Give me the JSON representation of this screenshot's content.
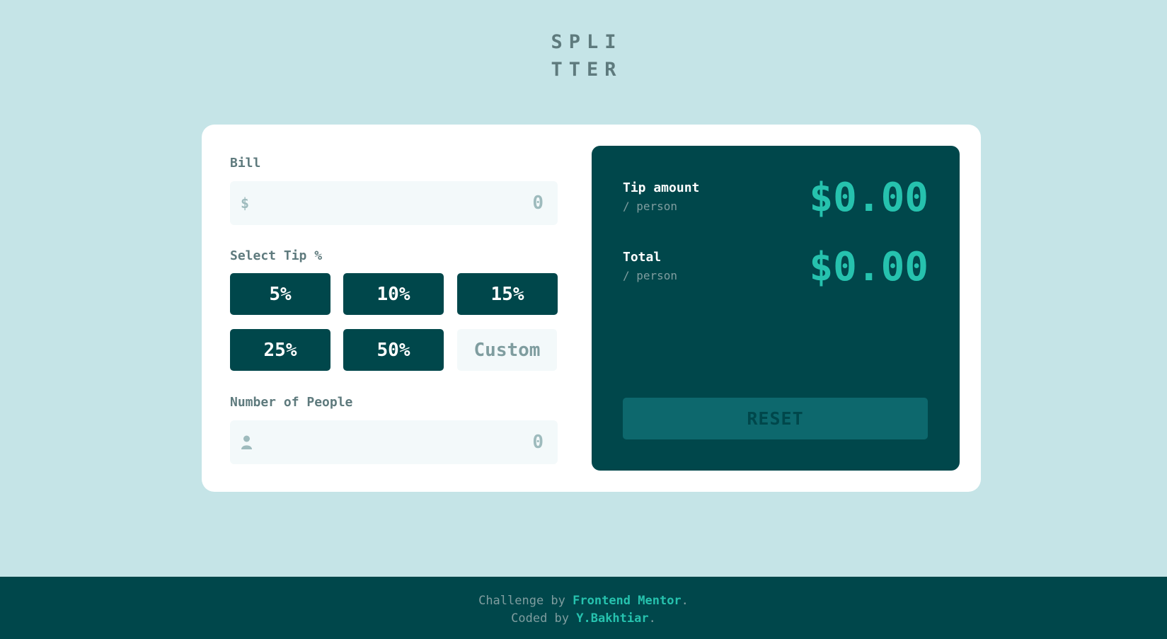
{
  "logo": {
    "line1": "SPLI",
    "line2": "TTER"
  },
  "bill": {
    "label": "Bill",
    "placeholder": "0",
    "icon": "dollar-icon",
    "icon_glyph": "$"
  },
  "tip": {
    "label": "Select Tip %",
    "options": [
      "5%",
      "10%",
      "15%",
      "25%",
      "50%"
    ],
    "custom_placeholder": "Custom"
  },
  "people": {
    "label": "Number of People",
    "placeholder": "0",
    "icon": "person-icon"
  },
  "results": {
    "tip_label": "Tip amount",
    "tip_sub": "/ person",
    "tip_value": "$0.00",
    "total_label": "Total",
    "total_sub": "/ person",
    "total_value": "$0.00",
    "reset_label": "RESET"
  },
  "footer": {
    "line1_prefix": "Challenge by ",
    "line1_link": "Frontend Mentor",
    "line1_suffix": ".",
    "line2_prefix": "Coded by ",
    "line2_link": "Y.Bakhtiar",
    "line2_suffix": "."
  },
  "colors": {
    "background": "#c5e4e7",
    "dark_cyan": "#00474b",
    "accent": "#26c2ae",
    "input_bg": "#f3f9fa",
    "reset_disabled": "#0d686d",
    "label_gray": "#5e7a7d"
  }
}
